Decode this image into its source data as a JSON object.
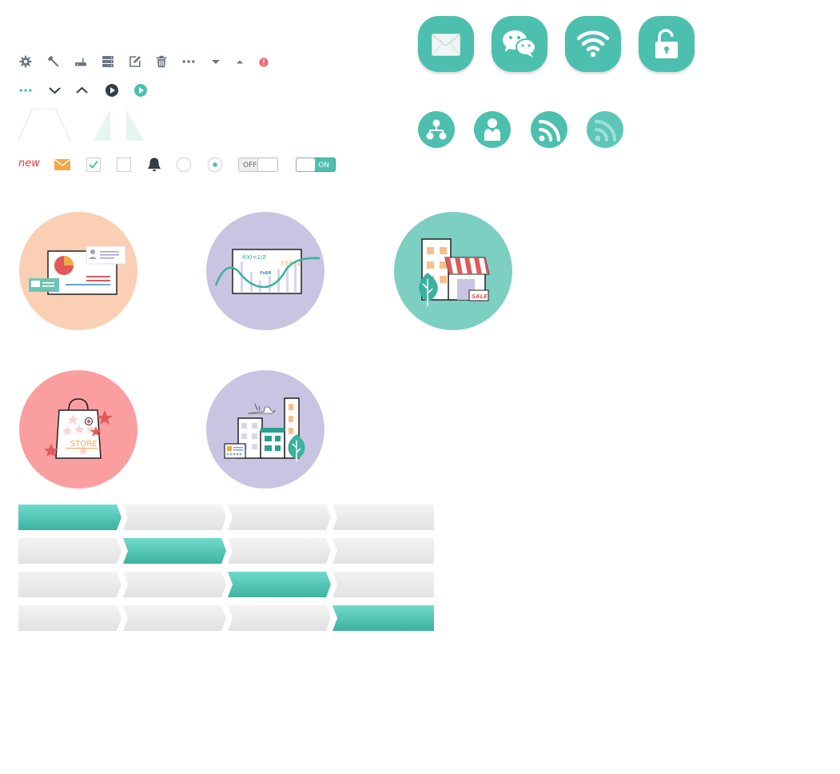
{
  "toolbar_row1": {
    "icons": [
      "gear-icon",
      "wrench-icon",
      "router-icon",
      "database-icon",
      "edit-icon",
      "trash-icon",
      "more-icon",
      "caret-down-icon",
      "caret-up-icon",
      "alert-dot-icon"
    ]
  },
  "toolbar_row2": {
    "icons": [
      "more-teal-icon",
      "chevron-down-icon",
      "chevron-up-icon",
      "play-dark-icon",
      "play-teal-icon"
    ]
  },
  "form_controls": {
    "new_label": "new",
    "switch_off_label": "OFF",
    "switch_on_label": "ON",
    "checkbox_checked": true,
    "checkbox_unchecked": false,
    "radio_selected": true
  },
  "tiles": [
    "mail-icon",
    "wechat-icon",
    "wifi-icon",
    "unlock-icon"
  ],
  "round_icons": [
    "sitemap-icon",
    "user-icon",
    "rss-icon",
    "rss-light-icon"
  ],
  "illustrations": {
    "chalkboard_formula_1": "f(X)=1/2",
    "chalkboard_formula_2": "X+Y=Z",
    "chalkboard_note": "PxBR",
    "shop_sign": "SALE",
    "bag_label": "STORE"
  },
  "step_bars": {
    "count": 4,
    "rows": [
      {
        "active_step": 1
      },
      {
        "active_step": 2
      },
      {
        "active_step": 3
      },
      {
        "active_step": 4
      }
    ]
  },
  "colors": {
    "accent": "#4dbfae",
    "icon_gray": "#6b7480",
    "dark": "#333c47",
    "alert": "#f06b7a",
    "orange": "#f3a843",
    "peach": "#fbcfb3",
    "lavender": "#c8c4e2",
    "mint": "#7dcfc2",
    "pink": "#fb9ea0"
  }
}
